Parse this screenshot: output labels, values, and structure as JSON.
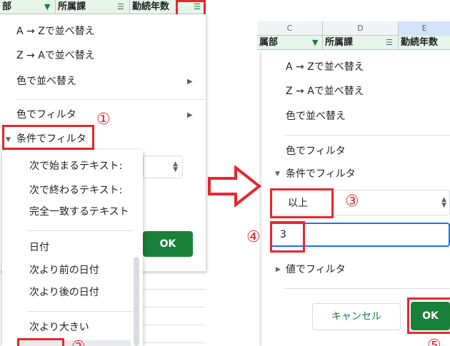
{
  "left": {
    "header": {
      "col_dept": "部",
      "col_section": "所属課",
      "col_years": "勤続年数"
    },
    "menu": {
      "sort_az": "A → Zで並べ替え",
      "sort_za": "Z → Aで並べ替え",
      "sort_color": "色で並べ替え",
      "filter_color": "色でフィルタ",
      "filter_condition": "条件でフィルタ"
    },
    "ok_label": "OK",
    "dropdown": [
      "次で始まるテキスト:",
      "次で終わるテキスト:",
      "完全一致するテキスト",
      "日付",
      "次より前の日付",
      "次より後の日付",
      "次より大きい"
    ],
    "step1": "①",
    "step2_partial": "②"
  },
  "right": {
    "columns": {
      "c": "C",
      "d": "D",
      "e": "E"
    },
    "header": {
      "col_dept": "属部",
      "col_section": "所属課",
      "col_years": "勤続年数"
    },
    "menu": {
      "sort_az": "A → Zで並べ替え",
      "sort_za": "Z → Aで並べ替え",
      "sort_color": "色で並べ替え",
      "filter_color": "色でフィルタ",
      "filter_condition": "条件でフィルタ",
      "filter_value": "値でフィルタ"
    },
    "condition_selected": "以上",
    "value_input": "3",
    "cancel_label": "キャンセル",
    "ok_label": "OK",
    "step3": "③",
    "step4": "④",
    "step5_partial": "⑤"
  },
  "colors": {
    "accent_green": "#188038",
    "annotation_red": "#e8262e",
    "focus_blue": "#1a73e8"
  },
  "icons": [
    "filter-icon",
    "arrow-right-icon",
    "triangle-down-icon",
    "up-down-icon",
    "right-arrow-outline-icon"
  ]
}
